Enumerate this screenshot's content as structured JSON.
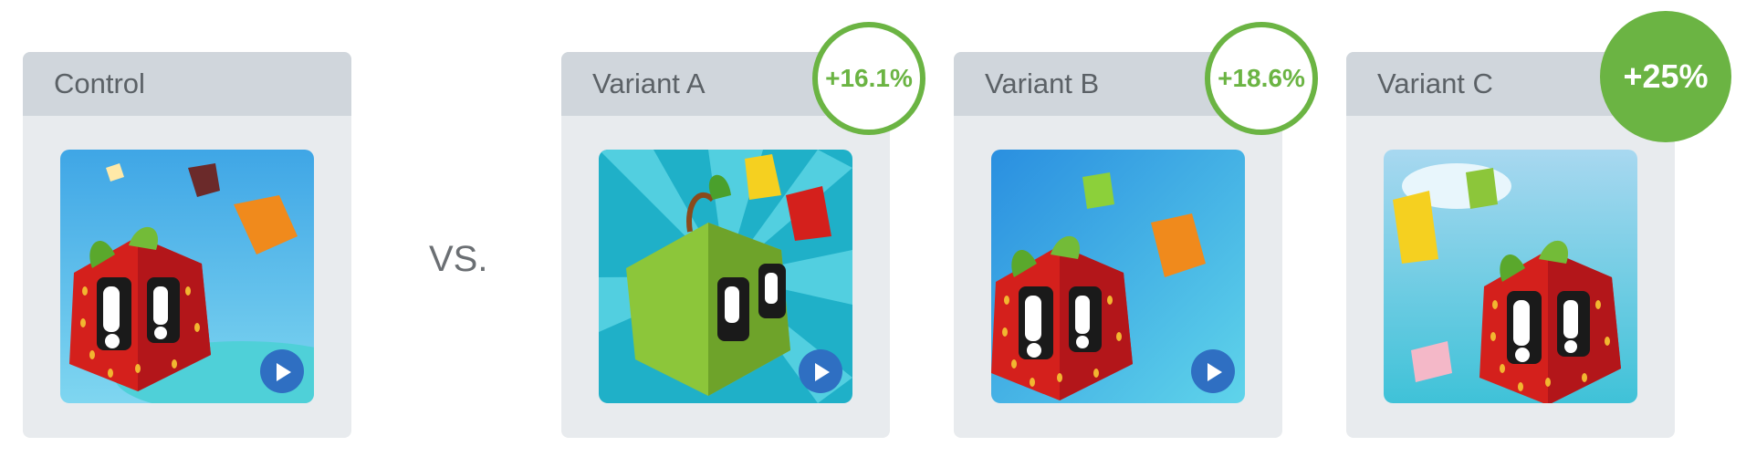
{
  "vs_label": "VS.",
  "colors": {
    "accent_green": "#6bb443",
    "card_bg": "#e8ebee",
    "header_bg": "#d0d6dc",
    "text_gray": "#5b6166"
  },
  "cards": [
    {
      "label": "Control",
      "icon": "strawberry-cube-game-icon",
      "badge": null
    },
    {
      "label": "Variant A",
      "icon": "apple-cube-game-icon",
      "badge": "+16.1%"
    },
    {
      "label": "Variant B",
      "icon": "strawberry-cube-game-icon",
      "badge": "+18.6%"
    },
    {
      "label": "Variant C",
      "icon": "strawberry-cube-game-icon",
      "badge": "+25%"
    }
  ]
}
